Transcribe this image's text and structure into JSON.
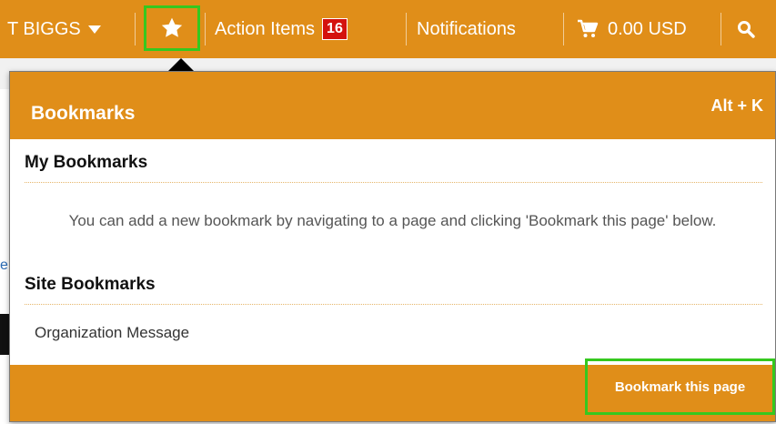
{
  "topbar": {
    "user_label": "T BIGGS",
    "action_items_label": "Action Items",
    "action_items_count": "16",
    "notifications_label": "Notifications",
    "cart_total": "0.00 USD"
  },
  "bookmarks_panel": {
    "title": "Bookmarks",
    "shortcut": "Alt + K",
    "my_bookmarks_heading": "My Bookmarks",
    "empty_message": "You can add a new bookmark by navigating to a page and clicking 'Bookmark this page' below.",
    "site_bookmarks_heading": "Site Bookmarks",
    "site_bookmarks": [
      "Organization Message"
    ],
    "bookmark_page_label": "Bookmark this page"
  },
  "colors": {
    "accent": "#e08e19",
    "badge": "#d4120e",
    "highlight": "#35c81f"
  },
  "icons": [
    "caret-down-icon",
    "star-icon",
    "cart-icon",
    "search-icon"
  ]
}
